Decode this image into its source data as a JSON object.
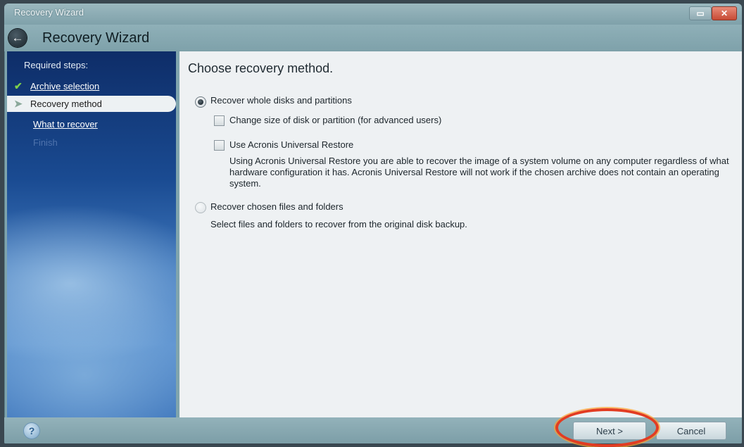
{
  "window": {
    "title": "Recovery Wizard",
    "controls": {
      "restore": "▭",
      "close": "✕"
    }
  },
  "header": {
    "back_icon": "back-arrow-icon",
    "title": "Recovery Wizard"
  },
  "sidebar": {
    "heading": "Required steps:",
    "steps": [
      {
        "label": "Archive selection",
        "state": "completed",
        "icon": "check-icon"
      },
      {
        "label": "Recovery method",
        "state": "current",
        "icon": "arrow-icon"
      },
      {
        "label": "What to recover",
        "state": "pending"
      },
      {
        "label": "Finish",
        "state": "disabled"
      }
    ]
  },
  "content": {
    "title": "Choose recovery method.",
    "options": {
      "whole_disks": {
        "label": "Recover whole disks and partitions",
        "selected": true
      },
      "change_size": {
        "label": "Change size of disk or partition (for advanced users)",
        "checked": false
      },
      "universal_restore": {
        "label": "Use Acronis Universal Restore",
        "checked": false,
        "description": "Using Acronis Universal Restore you are able to recover the image of a system volume on any computer regardless of what hardware configuration it has. Acronis Universal Restore will not work if the chosen archive does not contain an operating system."
      },
      "files_folders": {
        "label": "Recover chosen files and folders",
        "selected": false,
        "description": "Select files and folders to recover from the original disk backup."
      }
    }
  },
  "footer": {
    "help_icon": "help-icon",
    "next_label": "Next >",
    "cancel_label": "Cancel"
  },
  "colors": {
    "annotation_ring": "#e23c22",
    "sidebar_top": "#0e2d68",
    "window_chrome": "#7fa4ad"
  }
}
